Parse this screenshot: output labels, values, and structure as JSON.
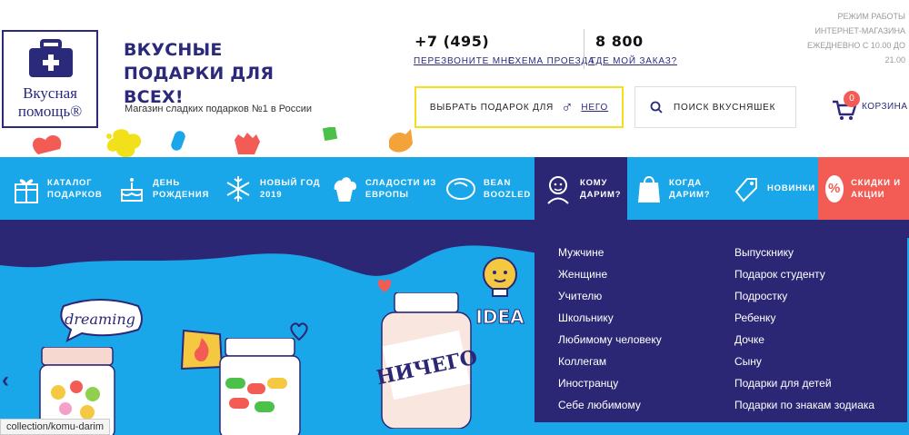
{
  "header": {
    "logo_text": "Вкусная помощь®",
    "tagline": "ВКУСНЫЕ ПОДАРКИ ДЛЯ ВСЕХ!",
    "subtagline": "Магазин сладких подарков №1 в России",
    "phone_moscow": "+7 (495)",
    "phone_russia": "8 800",
    "link_callback": "Перезвоните мне",
    "link_map": "Схема проезда",
    "link_order": "Где мой заказ?",
    "work_hours": "Режим работы интернет-магазина ежедневно с 10.00 до 21.00",
    "gift_picker_label": "Выбрать подарок для",
    "gift_picker_gender_icon": "male-symbol-icon",
    "gift_picker_target": "него",
    "search_placeholder": "Поиск вкусняшек",
    "cart_label": "Корзина",
    "cart_count": "0"
  },
  "nav": {
    "items": [
      {
        "label": "Каталог подарков",
        "icon": "gift-icon"
      },
      {
        "label": "День рождения",
        "icon": "cake-icon"
      },
      {
        "label": "Новый год 2019",
        "icon": "snowflake-icon"
      },
      {
        "label": "Сладости из Европы",
        "icon": "cupcake-icon"
      },
      {
        "label": "Bean Boozled",
        "icon": "bean-icon"
      },
      {
        "label": "Кому дарим?",
        "icon": "person-icon"
      },
      {
        "label": "Когда дарим?",
        "icon": "gift-bag-icon"
      },
      {
        "label": "Новинки",
        "icon": "tag-icon"
      },
      {
        "label": "Скидки и акции",
        "icon": "percent-icon"
      }
    ]
  },
  "dropdown": {
    "col1": [
      "Мужчине",
      "Женщине",
      "Учителю",
      "Школьнику",
      "Любимому человеку",
      "Коллегам",
      "Иностранцу",
      "Себе любимому"
    ],
    "col2": [
      "Выпускнику",
      "Подарок студенту",
      "Подростку",
      "Ребенку",
      "Дочке",
      "Сыну",
      "Подарки для детей",
      "Подарки по знакам зодиака"
    ]
  },
  "banner": {
    "sticker_dreaming": "dreaming",
    "sticker_idea": "IDEA",
    "jar_label": "НИЧЕГО"
  },
  "status_bar": "collection/komu-darim",
  "colors": {
    "brand_navy": "#2c2775",
    "nav_blue": "#1aa7e9",
    "sale_red": "#f25c54",
    "picker_yellow": "#f1e01a"
  }
}
